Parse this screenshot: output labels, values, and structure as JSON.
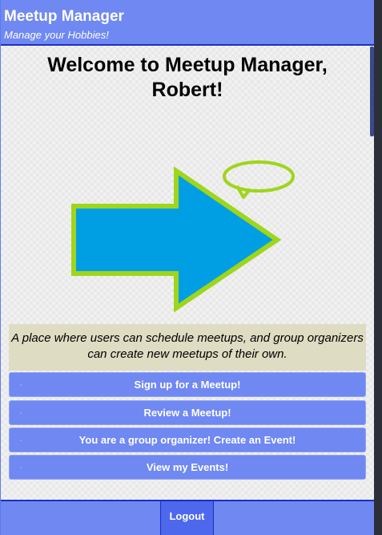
{
  "header": {
    "title": "Meetup Manager",
    "subtitle": "Manage your Hobbies!"
  },
  "welcome": {
    "line1": "Welcome to Meetup Manager,",
    "line2": "Robert!"
  },
  "hero": {
    "icon": "arrow-with-speech-bubble",
    "arrow_color": "#009fe3",
    "outline_color": "#9fd51a"
  },
  "tagline": "A place where users can schedule meetups, and group organizers can create new meetups of their own.",
  "menu": [
    {
      "label": "Sign up for a Meetup!"
    },
    {
      "label": "Review a Meetup!"
    },
    {
      "label": "You are a group organizer! Create an Event!"
    },
    {
      "label": "View my Events!"
    }
  ],
  "footer": {
    "logout_label": "Logout"
  },
  "colors": {
    "brand": "#6f88f2",
    "brand_dark": "#1c2fc4",
    "tagline_bg": "#dedcc2"
  }
}
